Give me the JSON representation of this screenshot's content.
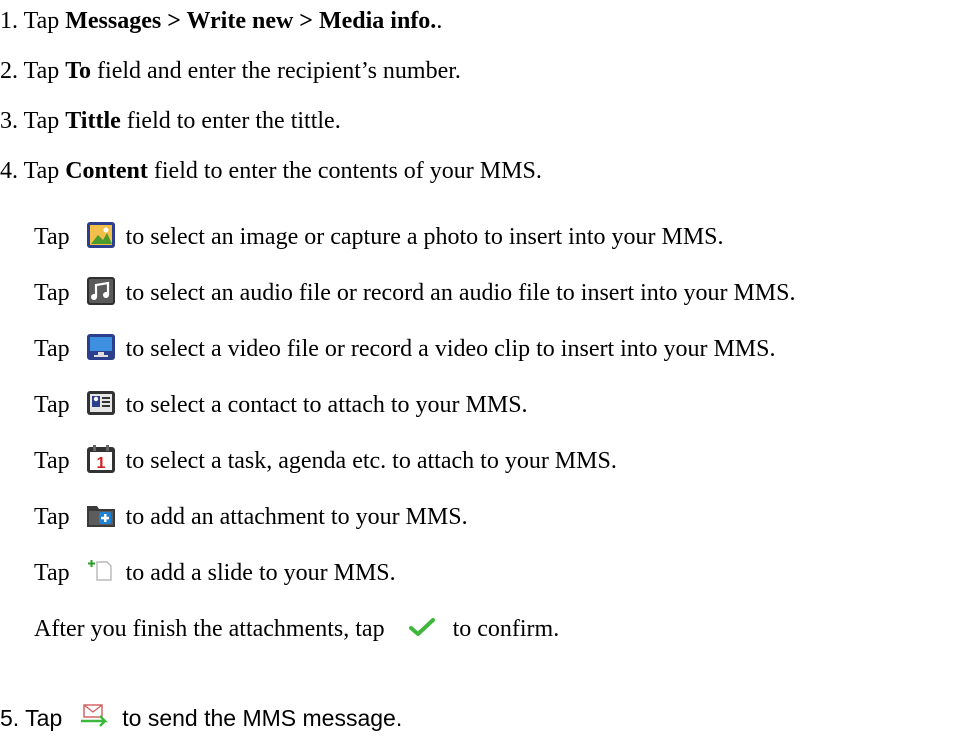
{
  "steps": [
    {
      "num": "1.",
      "pre": "Tap ",
      "bold": "Messages > Write new > Media info.",
      "post": "."
    },
    {
      "num": "2.",
      "pre": "Tap ",
      "bold": "To",
      "post": " field and enter the recipient’s number."
    },
    {
      "num": "3.",
      "pre": "Tap ",
      "bold": "Tittle",
      "post": " field to enter the tittle."
    },
    {
      "num": "4.",
      "pre": "Tap ",
      "bold": "Content",
      "post": " field to enter the contents of your MMS."
    }
  ],
  "attach_items": [
    {
      "pre": "Tap",
      "icon": "image-icon",
      "text": "to select an image or capture a photo to insert into your MMS."
    },
    {
      "pre": "Tap",
      "icon": "audio-icon",
      "text": "to select an audio file or record an audio file to insert into your MMS."
    },
    {
      "pre": "Tap",
      "icon": "video-icon",
      "text": "to select a video file or record a video clip to insert into your MMS."
    },
    {
      "pre": "Tap",
      "icon": "contact-icon",
      "text": "to select a contact to attach to your MMS."
    },
    {
      "pre": "Tap",
      "icon": "calendar-icon",
      "text": "to select a task, agenda etc. to attach to your MMS."
    },
    {
      "pre": "Tap",
      "icon": "add-attachment-icon",
      "text": "to add an attachment to your MMS."
    },
    {
      "pre": "Tap",
      "icon": "add-slide-icon",
      "text": "to add a slide to your MMS."
    }
  ],
  "finish": {
    "pre": "After you finish the attachments, tap",
    "icon": "checkmark-icon",
    "post": "to confirm."
  },
  "step5": {
    "num": "5.",
    "pre": "Tap",
    "icon": "send-mms-icon",
    "post": "to send the MMS message."
  }
}
